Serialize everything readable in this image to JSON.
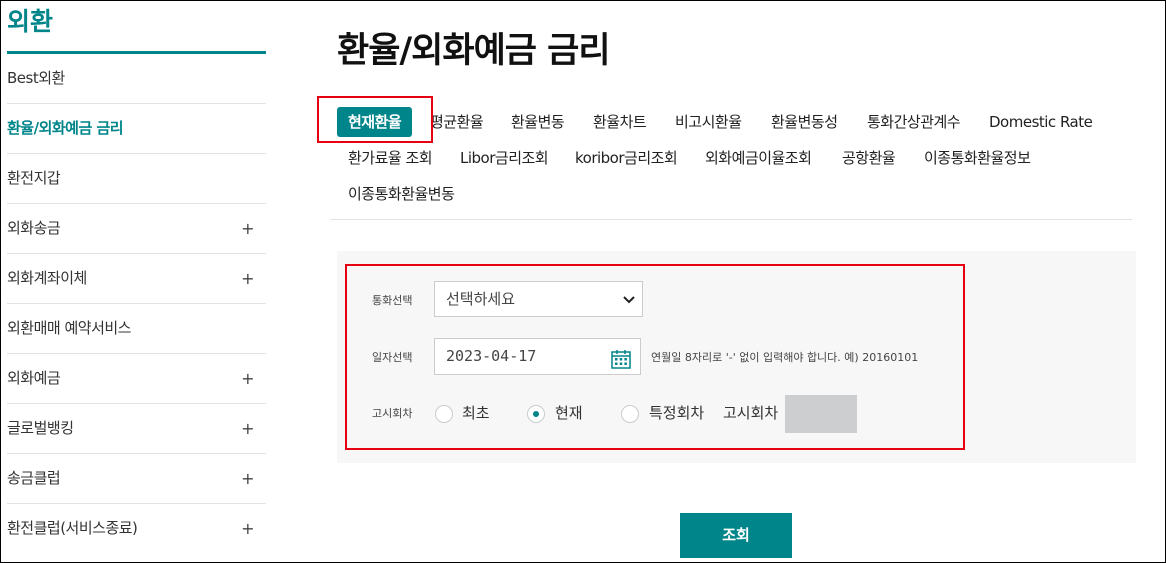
{
  "sidebar": {
    "title": "외환",
    "items": [
      {
        "label": "Best외환",
        "plus": ""
      },
      {
        "label": "환율/외화예금 금리",
        "plus": ""
      },
      {
        "label": "환전지갑",
        "plus": ""
      },
      {
        "label": "외화송금",
        "plus": "+"
      },
      {
        "label": "외화계좌이체",
        "plus": "+"
      },
      {
        "label": "외환매매 예약서비스",
        "plus": ""
      },
      {
        "label": "외화예금",
        "plus": "+"
      },
      {
        "label": "글로벌뱅킹",
        "plus": "+"
      },
      {
        "label": "송금클럽",
        "plus": "+"
      },
      {
        "label": "환전클럽(서비스종료)",
        "plus": "+"
      }
    ]
  },
  "main": {
    "title": "환율/외화예금 금리",
    "tabs": [
      "현재환율",
      "평균환율",
      "환율변동",
      "환율차트",
      "비고시환율",
      "환율변동성",
      "통화간상관계수",
      "Domestic Rate",
      "환가료율 조회",
      "Libor금리조회",
      "koribor금리조회",
      "외화예금이율조회",
      "공항환율",
      "이종통화환율정보",
      "이종통화환율변동"
    ]
  },
  "form": {
    "currency_label": "통화선택",
    "currency_value": "선택하세요",
    "date_label": "일자선택",
    "date_value": "2023-04-17",
    "date_hint": "연월일 8자리로 '-' 없이 입력해야 합니다. 예) 20160101",
    "round_label": "고시회차",
    "radio_first": "최초",
    "radio_current": "현재",
    "radio_specific": "특정회차",
    "round_input_label": "고시회차"
  },
  "buttons": {
    "search": "조회"
  },
  "colors": {
    "accent": "#00858a",
    "highlight": "#e60012"
  }
}
